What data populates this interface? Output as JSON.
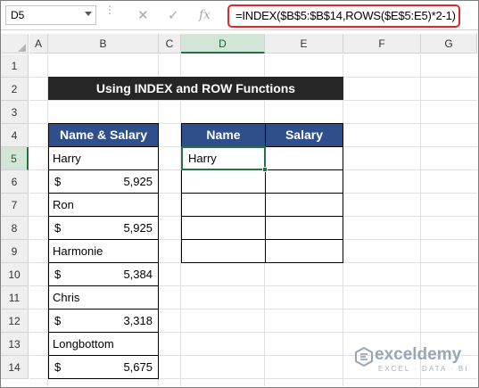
{
  "formula_bar": {
    "name_box": "D5",
    "cancel_icon": "✕",
    "enter_icon": "✓",
    "fx_icon": "fx",
    "formula": "=INDEX($B$5:$B$14,ROWS($E$5:E5)*2-1)"
  },
  "columns": [
    "A",
    "B",
    "C",
    "D",
    "E",
    "F",
    "G"
  ],
  "selected_column": "D",
  "rows": [
    "1",
    "2",
    "3",
    "4",
    "5",
    "6",
    "7",
    "8",
    "9",
    "10",
    "11",
    "12",
    "13",
    "14"
  ],
  "selected_row": "5",
  "title": "Using INDEX and ROW Functions",
  "source_table": {
    "header": "Name & Salary",
    "entries": [
      {
        "name": "Harry",
        "currency": "$",
        "amount": "5,925"
      },
      {
        "name": "Ron",
        "currency": "$",
        "amount": "5,925"
      },
      {
        "name": "Harmonie",
        "currency": "$",
        "amount": "5,384"
      },
      {
        "name": "Chris",
        "currency": "$",
        "amount": "3,318"
      },
      {
        "name": "Longbottom",
        "currency": "$",
        "amount": "5,675"
      }
    ]
  },
  "result_table": {
    "headers": [
      "Name",
      "Salary"
    ],
    "rows": [
      [
        "Harry",
        ""
      ],
      [
        "",
        ""
      ],
      [
        "",
        ""
      ],
      [
        "",
        ""
      ],
      [
        "",
        ""
      ]
    ]
  },
  "watermark": {
    "brand": "exceldemy",
    "tagline": "EXCEL · DATA · BI"
  },
  "colors": {
    "header_fill": "#2e4f8a",
    "title_fill": "#262626",
    "selection": "#217346",
    "formula_highlight": "#e0262b"
  }
}
